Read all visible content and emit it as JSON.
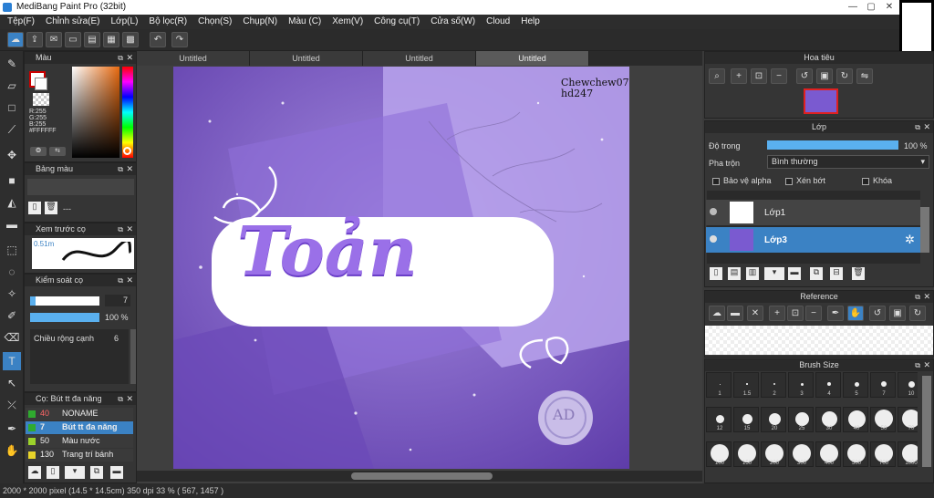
{
  "window": {
    "title": "MediBang Paint Pro (32bit)",
    "controls": [
      "—",
      "▢",
      "✕"
    ]
  },
  "menu": [
    "Tệp(F)",
    "Chỉnh sửa(E)",
    "Lớp(L)",
    "Bộ lọc(R)",
    "Chọn(S)",
    "Chụp(N)",
    "Màu (C)",
    "Xem(V)",
    "Công cụ(T)",
    "Cửa số(W)",
    "Cloud",
    "Help"
  ],
  "tabs": [
    "Untitled",
    "Untitled",
    "Untitled",
    "Untitled"
  ],
  "color_panel": {
    "title": "Màu",
    "r": "R:255",
    "g": "G:255",
    "b": "B:255",
    "hex": "#FFFFFF",
    "fg": "#ffffff",
    "bg": "#ffffff"
  },
  "palette_panel": {
    "title": "Bảng màu",
    "value": "---"
  },
  "brush_preview": {
    "title": "Xem trước cọ",
    "size": "0.51m"
  },
  "brush_control": {
    "title": "Kiểm soát cọ",
    "size": "7",
    "opacity": "100 %",
    "width_label": "Chiều rộng cạnh",
    "width_value": "6"
  },
  "brush_list": {
    "title": "Cọ: Bút tt đa năng",
    "items": [
      {
        "size": "40",
        "name": "NONAME",
        "color": "#2faa2f"
      },
      {
        "size": "7",
        "name": "Bút tt đa năng",
        "color": "#2faa2f",
        "selected": true
      },
      {
        "size": "50",
        "name": "Màu nước",
        "color": "#9cd22b"
      },
      {
        "size": "130",
        "name": "Trang trí bánh",
        "color": "#e8d42a"
      }
    ]
  },
  "navigator": {
    "title": "Hoa tiêu"
  },
  "layer_panel": {
    "title": "Lớp",
    "opacity_label": "Độ trong",
    "opacity": "100 %",
    "opacity_fraction": 1.0,
    "blend_label": "Pha trộn",
    "blend": "Bình thường",
    "protect_alpha": "Bảo vệ alpha",
    "clipping": "Xén bớt",
    "lock": "Khóa",
    "layers": [
      {
        "name": "Lớp1",
        "selected": false
      },
      {
        "name": "Lớp3",
        "selected": true
      }
    ]
  },
  "reference_panel": {
    "title": "Reference"
  },
  "brush_size_panel": {
    "title": "Brush Size",
    "sizes": [
      "1",
      "1.5",
      "2",
      "3",
      "4",
      "5",
      "7",
      "10",
      "12",
      "15",
      "20",
      "25",
      "30",
      "40",
      "50",
      "70",
      "100",
      "150",
      "200",
      "300",
      "400",
      "500",
      "700",
      "1000"
    ]
  },
  "canvas_text": {
    "signature1": "Chewchew07",
    "signature2": "hd247",
    "title": "Toản",
    "seal": "AD"
  },
  "status": {
    "text": "2000 * 2000 pixel   (14.5 * 14.5cm)   350 dpi   33 %   ( 567, 1457 )"
  }
}
